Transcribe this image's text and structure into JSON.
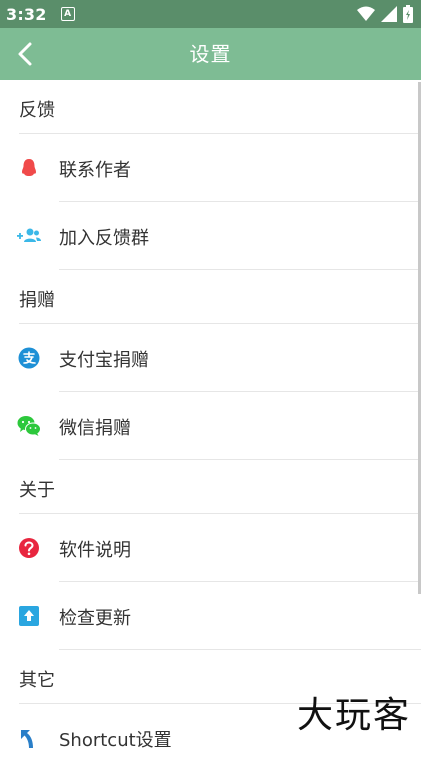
{
  "status": {
    "time": "3:32",
    "notif_letter": "A"
  },
  "app_bar": {
    "title": "设置"
  },
  "sections": [
    {
      "header": "反馈",
      "items": [
        {
          "label": "联系作者",
          "icon": "qq-icon"
        },
        {
          "label": "加入反馈群",
          "icon": "add-group-icon"
        }
      ]
    },
    {
      "header": "捐赠",
      "items": [
        {
          "label": "支付宝捐赠",
          "icon": "alipay-icon"
        },
        {
          "label": "微信捐赠",
          "icon": "wechat-icon"
        }
      ]
    },
    {
      "header": "关于",
      "items": [
        {
          "label": "软件说明",
          "icon": "help-icon"
        },
        {
          "label": "检查更新",
          "icon": "update-icon"
        }
      ]
    },
    {
      "header": "其它",
      "items": [
        {
          "label": "Shortcut设置",
          "icon": "shortcut-icon"
        }
      ]
    }
  ],
  "watermark": "大玩客",
  "colors": {
    "status_bar": "#5a8e6a",
    "app_bar": "#7ebc94",
    "qq_red": "#f04a4a",
    "group_blue": "#3bb8e8",
    "alipay_blue": "#1e90d6",
    "wechat_green": "#2dc83c",
    "help_red": "#e8263f",
    "update_blue": "#2aa6e0"
  }
}
